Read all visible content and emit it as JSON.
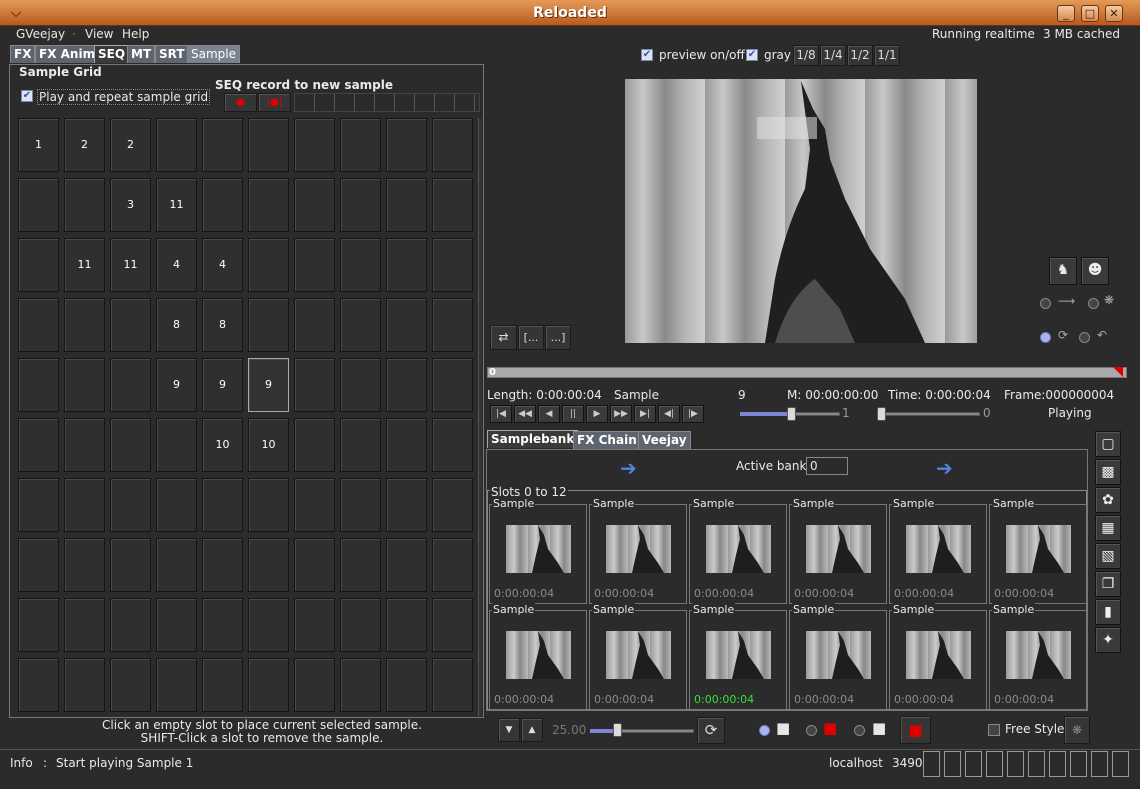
{
  "window": {
    "title": "Reloaded"
  },
  "menu": [
    "GVeejay",
    "View",
    "Help"
  ],
  "top_status": {
    "realtime": "Running realtime",
    "cache": "3 MB cached"
  },
  "tabs": [
    "FX",
    "FX Anim",
    "SEQ",
    "MT",
    "SRT",
    "Sample"
  ],
  "sample_grid": {
    "header": "Sample Grid",
    "repeat_label": "Play and repeat sample grid",
    "seq_record_label": "SEQ record to new sample",
    "cells": [
      [
        "1",
        "2",
        "2",
        "",
        "",
        "",
        "",
        "",
        "",
        ""
      ],
      [
        "",
        "",
        "3",
        "11",
        "",
        "",
        "",
        "",
        "",
        ""
      ],
      [
        "",
        "11",
        "11",
        "4",
        "4",
        "",
        "",
        "",
        "",
        ""
      ],
      [
        "",
        "",
        "",
        "8",
        "8",
        "",
        "",
        "",
        "",
        ""
      ],
      [
        "",
        "",
        "",
        "9",
        "9",
        "9",
        "",
        "",
        "",
        ""
      ],
      [
        "",
        "",
        "",
        "",
        "10",
        "10",
        "",
        "",
        "",
        ""
      ],
      [
        "",
        "",
        "",
        "",
        "",
        "",
        "",
        "",
        "",
        ""
      ],
      [
        "",
        "",
        "",
        "",
        "",
        "",
        "",
        "",
        "",
        ""
      ],
      [
        "",
        "",
        "",
        "",
        "",
        "",
        "",
        "",
        "",
        ""
      ],
      [
        "",
        "",
        "",
        "",
        "",
        "",
        "",
        "",
        "",
        ""
      ]
    ],
    "hint1": "Click an empty slot to place current selected sample.",
    "hint2": "SHIFT-Click a slot to remove the sample."
  },
  "preview": {
    "toggle_label": "preview on/off",
    "gray_label": "gray",
    "scales": [
      "1/8",
      "1/4",
      "1/2",
      "1/1"
    ],
    "bracket_open": "[...",
    "bracket_close": "...]"
  },
  "progress": {
    "marker": "0"
  },
  "playback_info": {
    "length": "Length: 0:00:00:04",
    "mode": "Sample",
    "sample_id": "9",
    "marker": "M: 00:00:00:00",
    "time": "Time: 0:00:00:04",
    "frame": "Frame:000000004",
    "speed_value": "1",
    "slow_value": "0",
    "state": "Playing"
  },
  "bank_tabs": [
    "Samplebank",
    "FX Chain",
    "Veejay"
  ],
  "bank": {
    "active_label": "Active bank:",
    "active_value": "0",
    "slots_title": "Slots 0 to 12",
    "slot_label": "Sample",
    "slot_times": [
      "0:00:00:04",
      "0:00:00:04",
      "0:00:00:04",
      "0:00:00:04",
      "0:00:00:04",
      "0:00:00:04",
      "0:00:00:04",
      "0:00:00:04",
      "0:00:00:04",
      "0:00:00:04",
      "0:00:00:04",
      "0:00:00:04"
    ]
  },
  "bottom_controls": {
    "fps": "25.00",
    "free_style": "Free Style"
  },
  "statusbar": {
    "info_label": "Info",
    "info_sep": ":",
    "info_text": "Start playing Sample 1",
    "host": "localhost",
    "port": "3490"
  },
  "colors": {
    "title_bar": "#d07a3a",
    "record_red": "#e00000",
    "playing_time_green": "#3adf3a",
    "check_blue": "#3355bb"
  }
}
